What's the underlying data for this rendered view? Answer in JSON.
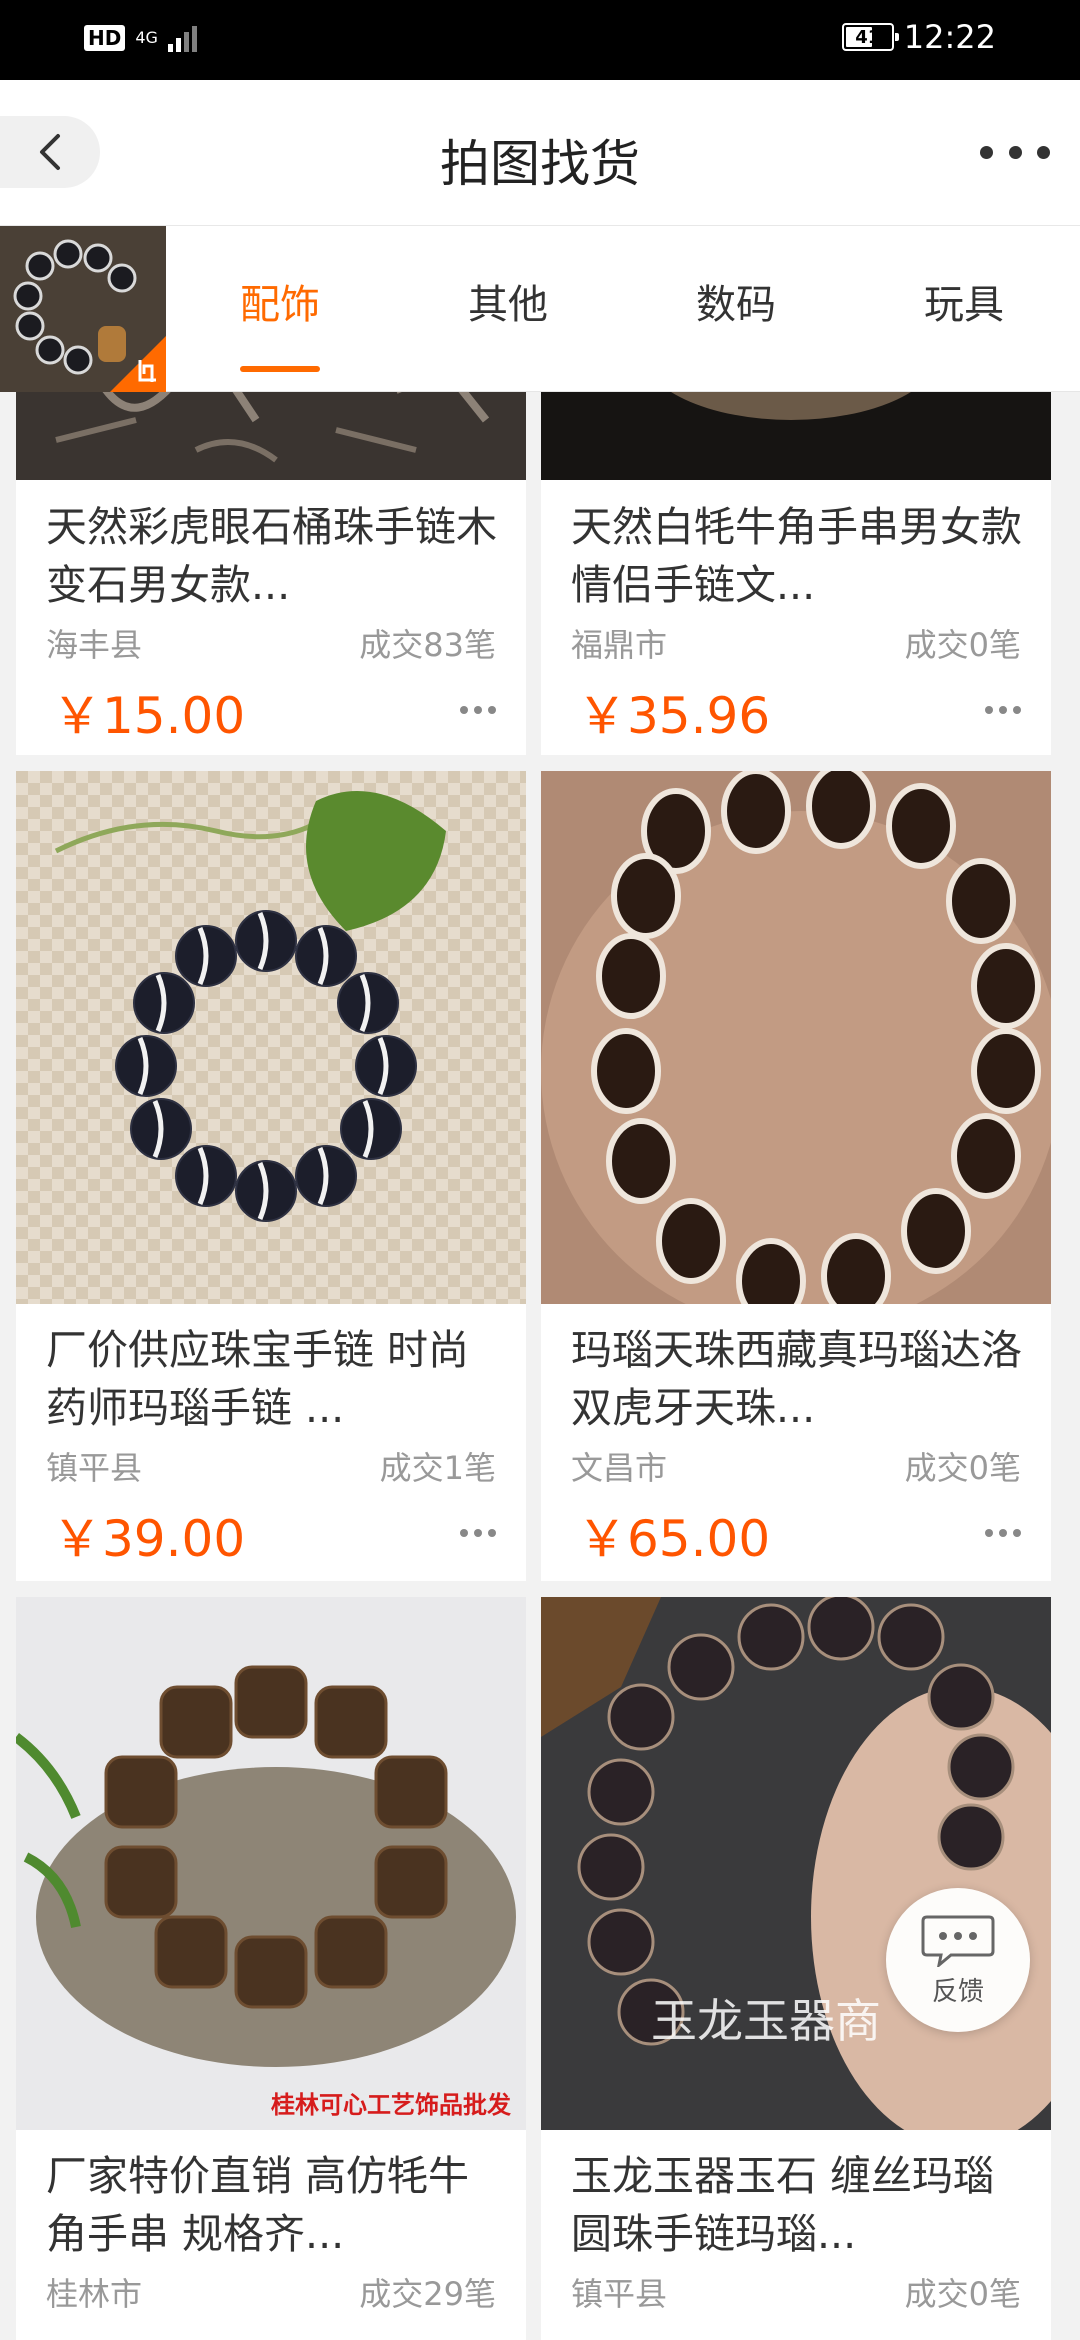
{
  "status_bar": {
    "hd": "HD",
    "network": "4G",
    "battery": "41",
    "time": "12:22"
  },
  "header": {
    "title": "拍图找货"
  },
  "tabs": [
    {
      "label": "配饰",
      "active": true
    },
    {
      "label": "其他",
      "active": false
    },
    {
      "label": "数码",
      "active": false
    },
    {
      "label": "玩具",
      "active": false
    }
  ],
  "products": [
    {
      "title": "天然彩虎眼石桶珠手链木变石男女款...",
      "location": "海丰县",
      "sales": "成交83笔",
      "price": "￥15.00"
    },
    {
      "title": "天然白牦牛角手串男女款情侣手链文...",
      "location": "福鼎市",
      "sales": "成交0笔",
      "price": "￥35.96"
    },
    {
      "title": "厂价供应珠宝手链 时尚药师玛瑙手链 ...",
      "location": "镇平县",
      "sales": "成交1笔",
      "price": "￥39.00"
    },
    {
      "title": "玛瑙天珠西藏真玛瑙达洛双虎牙天珠...",
      "location": "文昌市",
      "sales": "成交0笔",
      "price": "￥65.00"
    },
    {
      "title": "厂家特价直销 高仿牦牛角手串  规格齐...",
      "location": "桂林市",
      "sales": "成交29笔",
      "price": ""
    },
    {
      "title": "玉龙玉器玉石 缠丝玛瑙圆珠手链玛瑙...",
      "location": "镇平县",
      "sales": "成交0笔",
      "price": ""
    }
  ],
  "image_captions": {
    "product5_watermark": "桂林可心工艺饰品批发",
    "product6_watermark": "玉龙玉器商"
  },
  "feedback": {
    "label": "反馈"
  },
  "colors": {
    "accent": "#ff6a00",
    "price": "#ff5500",
    "status_bar": "#000000"
  }
}
